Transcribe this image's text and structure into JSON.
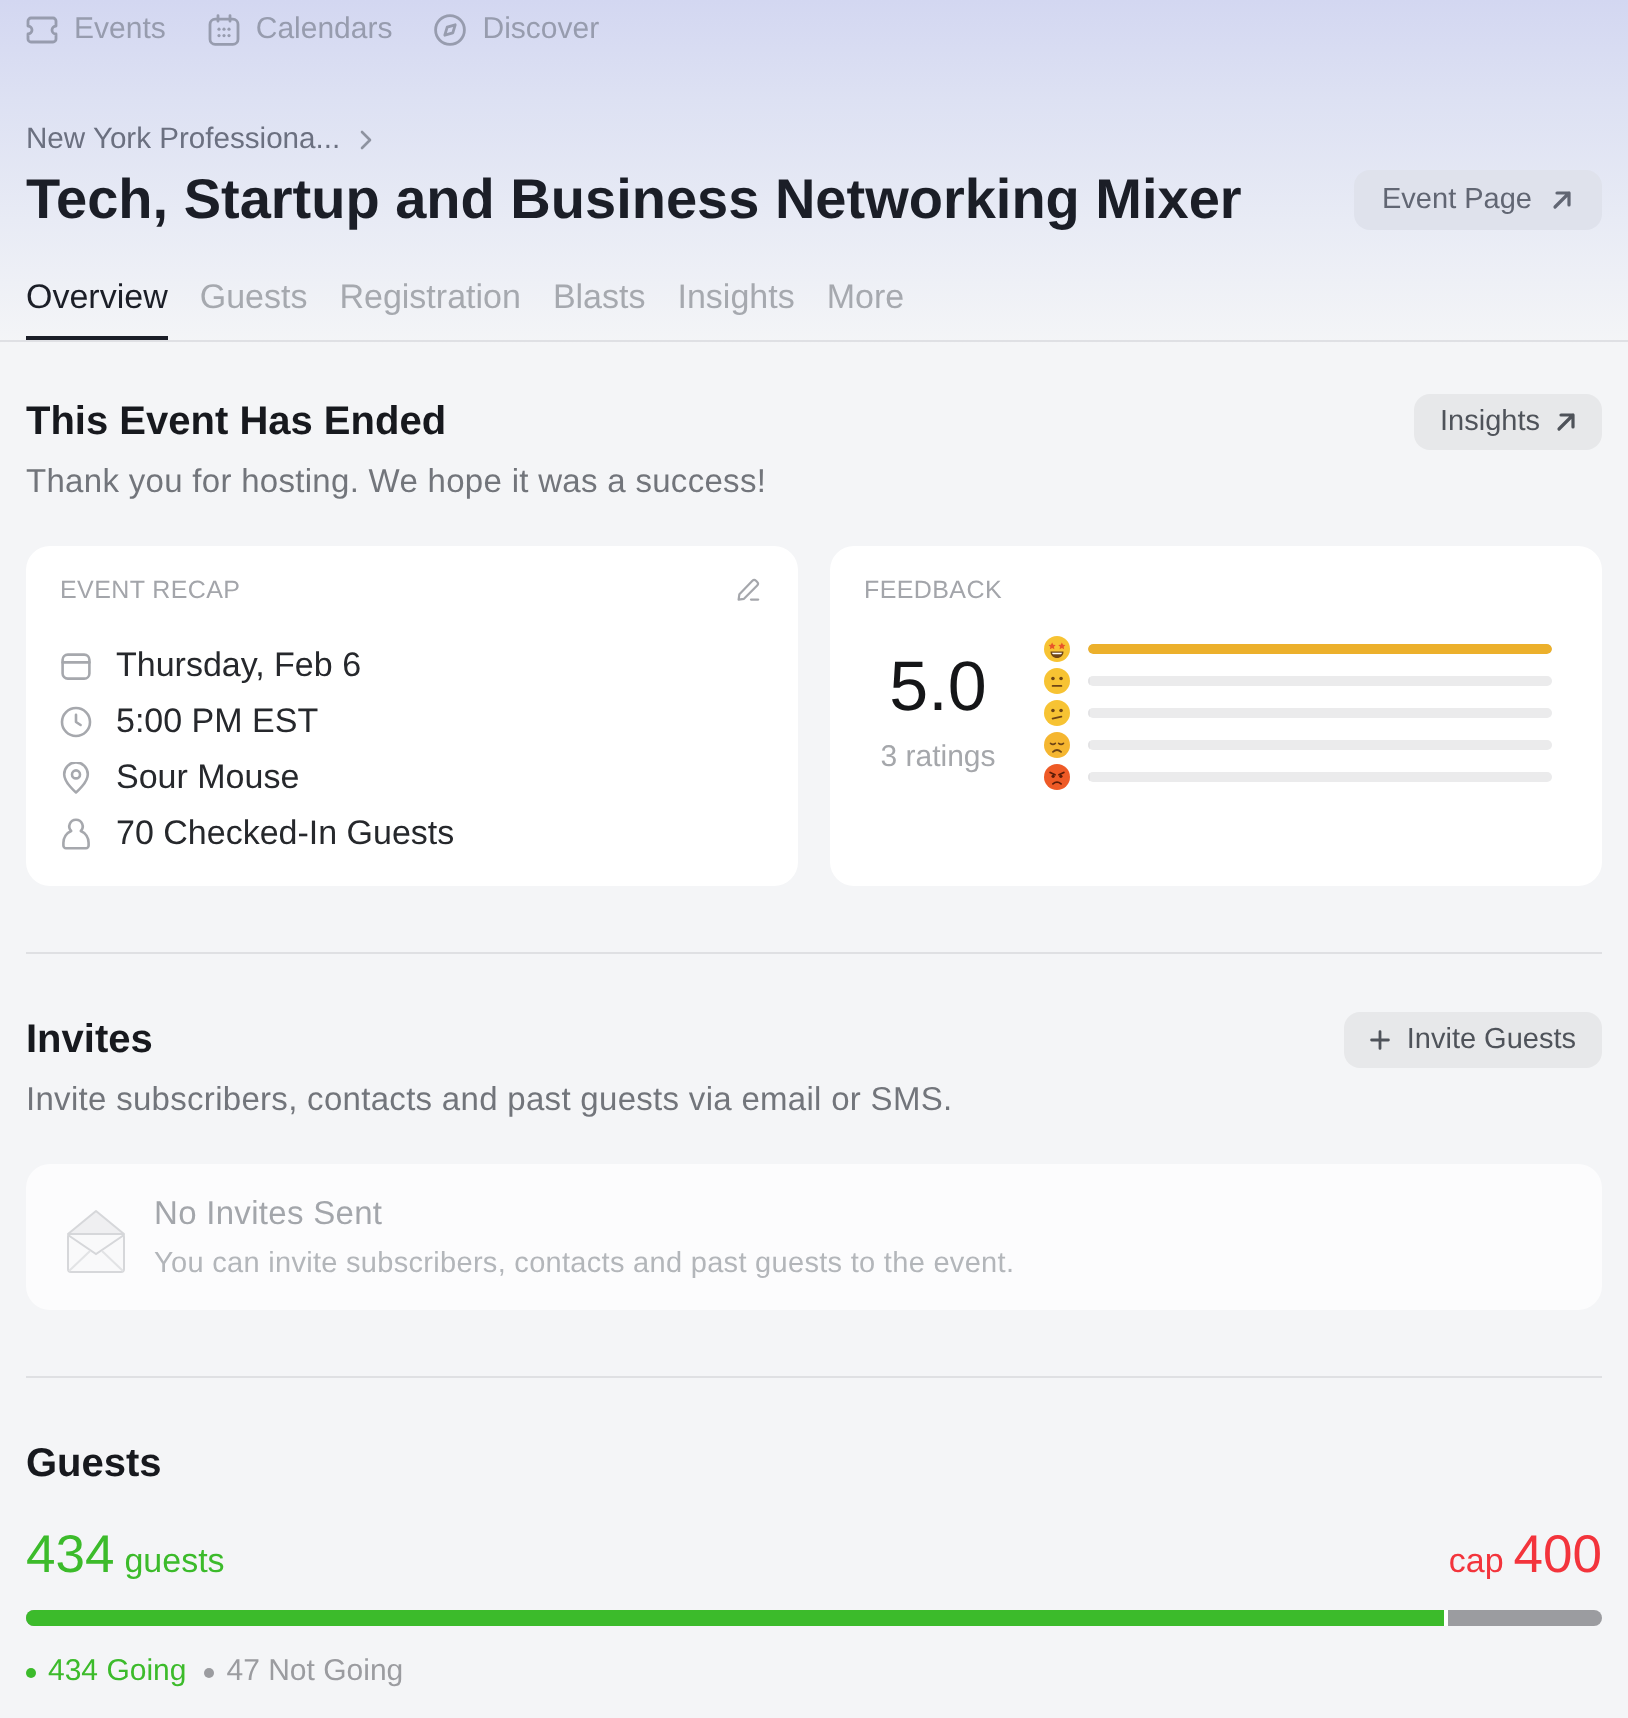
{
  "top_nav": [
    {
      "kind": "events",
      "label": "Events"
    },
    {
      "kind": "calendars",
      "label": "Calendars"
    },
    {
      "kind": "discover",
      "label": "Discover"
    }
  ],
  "breadcrumb": {
    "label": "New York Professiona..."
  },
  "header": {
    "title": "Tech, Startup and Business Networking Mixer",
    "button": "Event Page"
  },
  "tabs": [
    {
      "label": "Overview",
      "selected": true
    },
    {
      "label": "Guests",
      "selected": false
    },
    {
      "label": "Registration",
      "selected": false
    },
    {
      "label": "Blasts",
      "selected": false
    },
    {
      "label": "Insights",
      "selected": false
    },
    {
      "label": "More",
      "selected": false
    }
  ],
  "status": {
    "title": "This Event Has Ended",
    "subtitle": "Thank you for hosting. We hope it was a success!",
    "button": "Insights"
  },
  "event_recap": {
    "title": "EVENT RECAP",
    "details": [
      {
        "kind": "date",
        "text": "Thursday, Feb 6"
      },
      {
        "kind": "time",
        "text": "5:00 PM EST"
      },
      {
        "kind": "location",
        "text": "Sour Mouse"
      },
      {
        "kind": "checkins",
        "text": "70 Checked-In Guests"
      }
    ]
  },
  "feedback": {
    "title": "FEEDBACK",
    "score": "5.0",
    "count": "3 ratings",
    "ratings": [
      {
        "kind": "amazing",
        "level": 1
      },
      {
        "kind": "good",
        "level": 0
      },
      {
        "kind": "okay",
        "level": 0
      },
      {
        "kind": "bad",
        "level": 0
      },
      {
        "kind": "terrible",
        "level": 0
      }
    ]
  },
  "invites": {
    "title": "Invites",
    "subtitle": "Invite subscribers, contacts and past guests via email or SMS.",
    "button": "Invite Guests",
    "empty_state": {
      "title": "No Invites Sent",
      "text": "You can invite subscribers, contacts and past guests to the event."
    }
  },
  "guests": {
    "title": "Guests",
    "count": "434",
    "count_label": "guests",
    "cap_label": "cap",
    "cap": "400",
    "level": 0.902,
    "legend": [
      {
        "label": "434 Going",
        "color": "#3cbb2b"
      },
      {
        "label": "47 Not Going",
        "color": "#9b9ca0"
      }
    ]
  }
}
